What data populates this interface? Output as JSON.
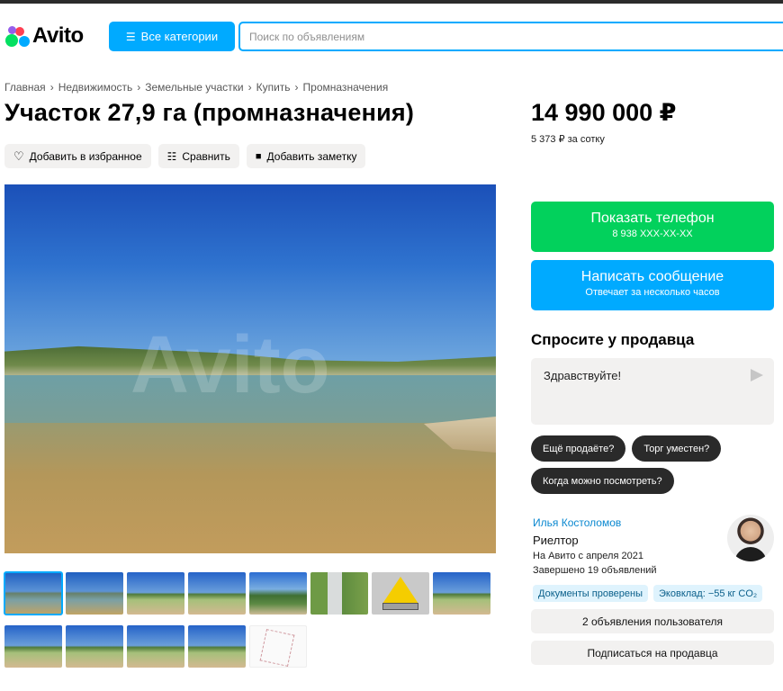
{
  "header": {
    "logo_text": "Avito",
    "categories_button": "Все категории",
    "search_placeholder": "Поиск по объявлениям"
  },
  "breadcrumb": [
    "Главная",
    "Недвижимость",
    "Земельные участки",
    "Купить",
    "Промназначения"
  ],
  "listing": {
    "title": "Участок 27,9 га (промназначения)",
    "price": "14 990 000 ₽",
    "price_per_unit": "5 373 ₽ за сотку"
  },
  "actions": {
    "favorite": "Добавить в избранное",
    "compare": "Сравнить",
    "note": "Добавить заметку"
  },
  "gallery": {
    "watermark": "Avito",
    "thumbnails_count": 13,
    "active_index": 0
  },
  "contact": {
    "phone_button": "Показать телефон",
    "phone_masked": "8 938 XXX-XX-XX",
    "message_button": "Написать сообщение",
    "message_sub": "Отвечает за несколько часов"
  },
  "ask": {
    "title": "Спросите у продавца",
    "message_value": "Здравствуйте!",
    "chips": [
      "Ещё продаёте?",
      "Торг уместен?",
      "Когда можно посмотреть?"
    ]
  },
  "seller": {
    "name": "Илья Костоломов",
    "role": "Риелтор",
    "since": "На Авито с апреля 2021",
    "completed": "Завершено 19 объявлений",
    "badges": [
      "Документы проверены",
      "Эковклад: −55 кг CO₂"
    ],
    "listings_button": "2 объявления пользователя",
    "subscribe_button": "Подписаться на продавца"
  },
  "colors": {
    "accent_blue": "#00aaff",
    "accent_green": "#02d15c",
    "chip_dark": "#2a2a2a",
    "secondary_bg": "#f2f1f0"
  }
}
